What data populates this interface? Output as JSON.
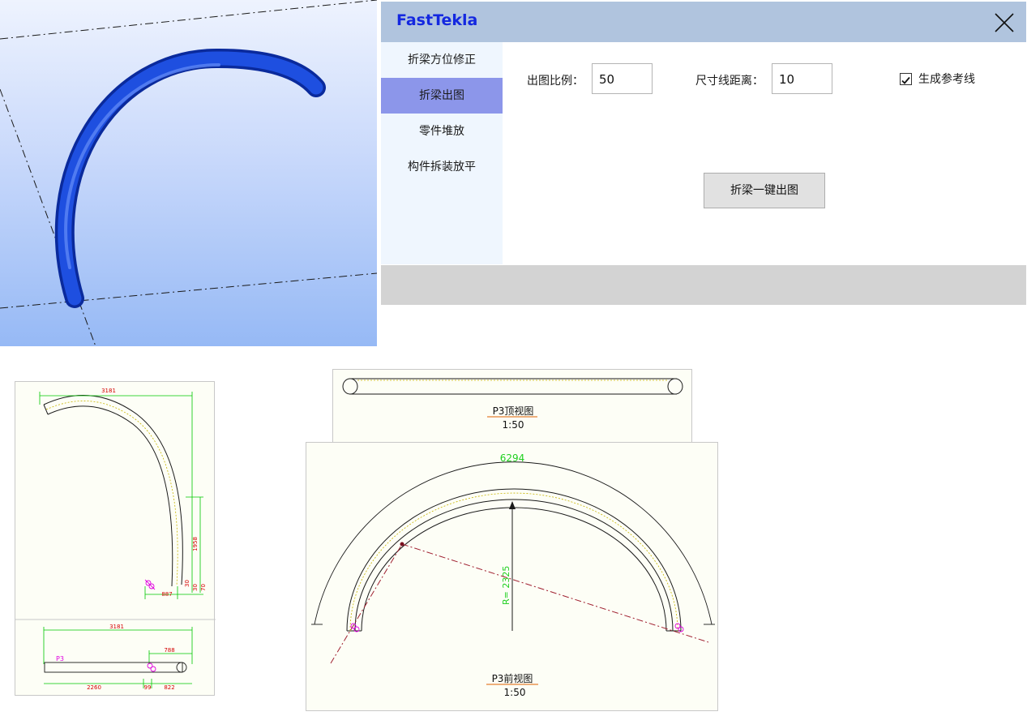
{
  "dialog": {
    "title": "FastTekla",
    "close_icon": "close-icon",
    "sidebar": {
      "items": [
        {
          "label": "折梁方位修正"
        },
        {
          "label": "折梁出图"
        },
        {
          "label": "零件堆放"
        },
        {
          "label": "构件拆装放平"
        }
      ],
      "active_index": 1
    },
    "form": {
      "scale_label": "出图比例：",
      "scale_value": "50",
      "dim_offset_label": "尺寸线距离：",
      "dim_offset_value": "10",
      "refline_label": "生成参考线",
      "refline_checked": true,
      "generate_button": "折梁一键出图"
    },
    "colors": {
      "titlebar": "#b0c4de",
      "title_text": "#1428e0",
      "sidebar_bg": "#eff6fe",
      "sidebar_active": "#8c96ea",
      "statusbar": "#d3d3d3"
    }
  },
  "drawing_left": {
    "front": {
      "dim_top": "3181",
      "dim_right": "1958",
      "dim_bottom": "887",
      "dim_small_a": "30",
      "dim_small_b": "30",
      "dim_small_c": "70"
    },
    "plan": {
      "dim_top": "3181",
      "dim_right": "788",
      "part_mark": "P3",
      "dim_bottom_a": "2260",
      "dim_bottom_b": "99",
      "dim_bottom_c": "822"
    }
  },
  "drawing_right": {
    "top_view": {
      "title": "P3顶视图",
      "scale": "1:50"
    },
    "front_view": {
      "arc_length": "6294",
      "radius": "R= 2325",
      "title": "P3前视图",
      "scale": "1:50"
    }
  }
}
